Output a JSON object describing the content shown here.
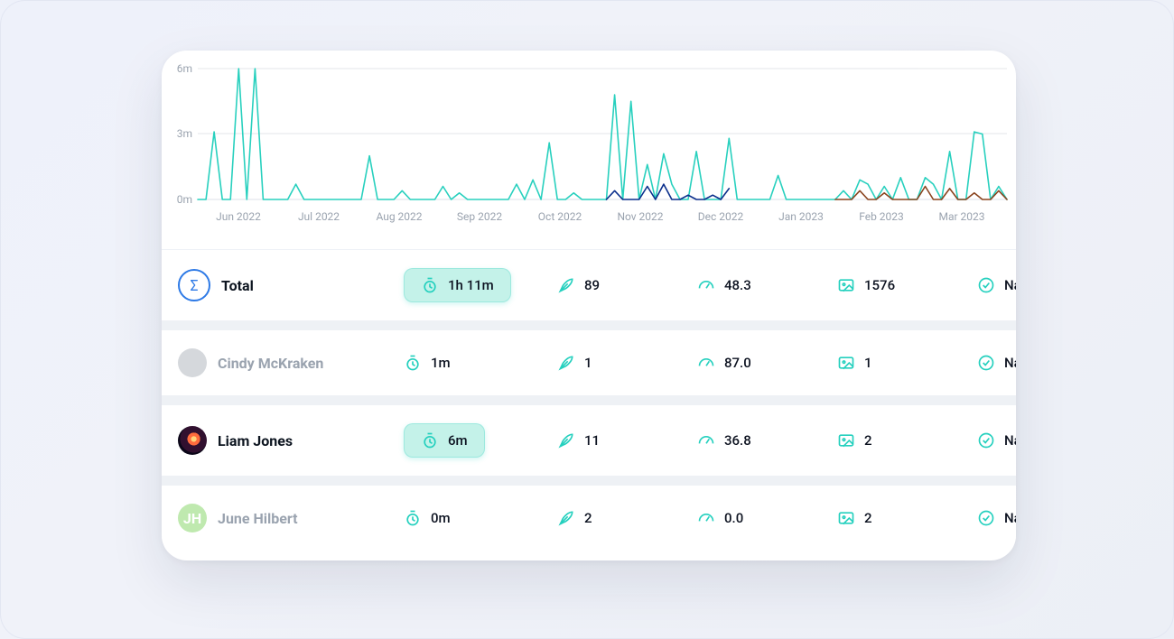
{
  "rows": [
    {
      "key": "total",
      "label": "Total",
      "avatar": {
        "type": "sigma"
      },
      "time": "1h 11m",
      "time_highlight": true,
      "posts": "89",
      "score": "48.3",
      "images": "1576",
      "percent": "NaN%",
      "muted": false
    },
    {
      "key": "cindy",
      "label": "Cindy McKraken",
      "avatar": {
        "type": "photo_gray"
      },
      "time": "1m",
      "time_highlight": false,
      "posts": "1",
      "score": "87.0",
      "images": "1",
      "percent": "NaN%",
      "muted": true
    },
    {
      "key": "liam",
      "label": "Liam Jones",
      "avatar": {
        "type": "galaxy"
      },
      "time": "6m",
      "time_highlight": true,
      "posts": "11",
      "score": "36.8",
      "images": "2",
      "percent": "NaN%",
      "muted": false
    },
    {
      "key": "june",
      "label": "June Hilbert",
      "avatar": {
        "type": "initials",
        "initials": "JH"
      },
      "time": "0m",
      "time_highlight": false,
      "posts": "2",
      "score": "0.0",
      "images": "2",
      "percent": "NaN%",
      "muted": true
    }
  ],
  "chart_data": {
    "type": "line",
    "title": "",
    "xlabel": "",
    "ylabel": "",
    "ylim": [
      0,
      6
    ],
    "y_ticks": [
      "0m",
      "3m",
      "6m"
    ],
    "x_ticks": [
      "Jun 2022",
      "Jul 2022",
      "Aug 2022",
      "Sep 2022",
      "Oct 2022",
      "Nov 2022",
      "Dec 2022",
      "Jan 2023",
      "Feb 2023",
      "Mar 2023"
    ],
    "series": [
      {
        "name": "activity_teal",
        "color": "#28d0be",
        "x": [
          0,
          1,
          2,
          3,
          4,
          5,
          6,
          7,
          8,
          9,
          10,
          11,
          12,
          13,
          14,
          15,
          16,
          17,
          18,
          19,
          20,
          21,
          22,
          23,
          24,
          25,
          26,
          27,
          28,
          29,
          30,
          31,
          32,
          33,
          34,
          35,
          36,
          37,
          38,
          39,
          40,
          41,
          42,
          43,
          44,
          45,
          46,
          47,
          48,
          49,
          50,
          51,
          52,
          53,
          54,
          55,
          56,
          57,
          58,
          59,
          60,
          61,
          62,
          63,
          64,
          65,
          66,
          67,
          68,
          69,
          70,
          71,
          72,
          73,
          74,
          75,
          76,
          77,
          78,
          79,
          80,
          81,
          82,
          83,
          84,
          85,
          86,
          87,
          88,
          89,
          90,
          91,
          92,
          93,
          94,
          95,
          96,
          97,
          98,
          99
        ],
        "values": [
          0,
          0,
          3.1,
          0,
          0,
          6.5,
          0,
          6.5,
          0,
          0,
          0,
          0,
          0.7,
          0,
          0,
          0,
          0,
          0,
          0,
          0,
          0,
          2.0,
          0,
          0,
          0,
          0.4,
          0,
          0,
          0,
          0,
          0.6,
          0,
          0.3,
          0,
          0,
          0,
          0,
          0,
          0,
          0.7,
          0,
          0.9,
          0,
          2.6,
          0,
          0,
          0.3,
          0,
          0,
          0,
          0,
          4.8,
          0,
          4.5,
          0,
          1.6,
          0,
          2.1,
          0.7,
          0,
          0,
          2.2,
          0,
          0,
          0,
          2.8,
          0,
          0,
          0,
          0,
          0,
          1.1,
          0,
          0,
          0,
          0,
          0,
          0,
          0,
          0.4,
          0,
          0.9,
          0.7,
          0,
          0.6,
          0,
          1.0,
          0,
          0,
          1.0,
          0.7,
          0,
          2.2,
          0,
          0,
          3.1,
          3.0,
          0,
          0.6,
          0
        ]
      },
      {
        "name": "activity_navy",
        "color": "#0b2f8c",
        "x": [
          50,
          51,
          52,
          53,
          54,
          55,
          56,
          57,
          58,
          59,
          60,
          61,
          62,
          63,
          64,
          65
        ],
        "values": [
          0,
          0.4,
          0,
          0,
          0,
          0.6,
          0,
          0.7,
          0,
          0,
          0.2,
          0,
          0,
          0.2,
          0,
          0.5
        ]
      },
      {
        "name": "activity_brown",
        "color": "#8a441f",
        "x": [
          78,
          79,
          80,
          81,
          82,
          83,
          84,
          85,
          86,
          87,
          88,
          89,
          90,
          91,
          92,
          93,
          94,
          95,
          96,
          97,
          98,
          99
        ],
        "values": [
          0,
          0,
          0,
          0.4,
          0,
          0,
          0.3,
          0,
          0,
          0,
          0,
          0.6,
          0,
          0,
          0.5,
          0,
          0,
          0.3,
          0,
          0,
          0.4,
          0
        ]
      }
    ]
  },
  "icons": {
    "stopwatch": "stopwatch-icon",
    "feather": "feather-icon",
    "gauge": "gauge-icon",
    "image": "image-icon",
    "check": "check-circle-icon",
    "sigma": "sigma-icon"
  }
}
